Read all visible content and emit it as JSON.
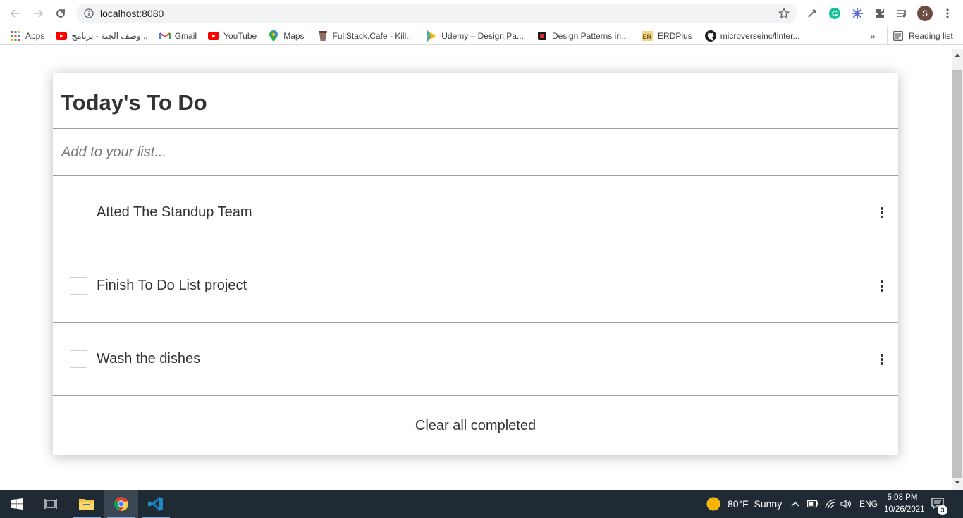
{
  "browser": {
    "url": "localhost:8080",
    "avatar_letter": "S",
    "bookmarks": [
      {
        "label": "Apps",
        "icon": "apps-grid-icon"
      },
      {
        "label": "وصف الجنة - برنامج...",
        "icon": "youtube-icon"
      },
      {
        "label": "Gmail",
        "icon": "gmail-icon"
      },
      {
        "label": "YouTube",
        "icon": "youtube-icon"
      },
      {
        "label": "Maps",
        "icon": "maps-icon"
      },
      {
        "label": "FullStack.Cafe - Kill...",
        "icon": "cafe-icon"
      },
      {
        "label": "Udemy – Design Pa...",
        "icon": "udemy-icon"
      },
      {
        "label": "Design Patterns in...",
        "icon": "design-patterns-icon"
      },
      {
        "label": "ERDPlus",
        "icon": "erdplus-icon"
      },
      {
        "label": "microverseinc/linter...",
        "icon": "github-icon"
      }
    ],
    "overflow": "»",
    "reading_list": "Reading list"
  },
  "todo": {
    "title": "Today's To Do",
    "input_placeholder": "Add to your list...",
    "tasks": [
      {
        "label": "Atted The Standup Team",
        "completed": false
      },
      {
        "label": "Finish To Do List project",
        "completed": false
      },
      {
        "label": "Wash the dishes",
        "completed": false
      }
    ],
    "clear_label": "Clear all completed"
  },
  "taskbar": {
    "weather": "80°F  Sunny",
    "language": "ENG",
    "time": "5:08 PM",
    "date": "10/26/2021",
    "notifications": "3"
  },
  "colors": {
    "chrome_bg": "#ffffff",
    "omnibox_bg": "#f1f3f4",
    "taskbar_bg": "#1f2a35",
    "divider": "#9e9e9e",
    "text": "#333333"
  }
}
